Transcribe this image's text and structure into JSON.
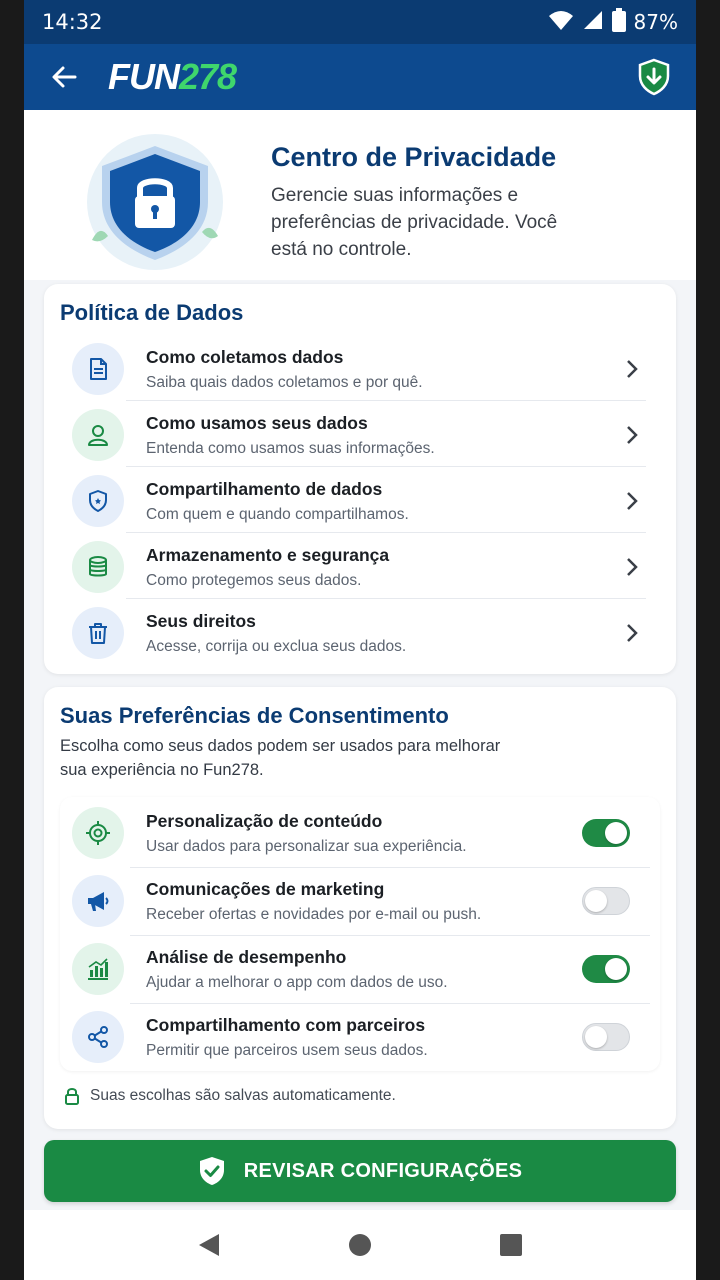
{
  "status": {
    "time": "14:32",
    "battery": "87%"
  },
  "appbar": {
    "logo_fun": "FUN",
    "logo_num": "278",
    "back_icon": "arrow-left-icon",
    "shield_icon": "shield-download-icon"
  },
  "hero": {
    "title": "Centro de Privacidade",
    "subtitle": "Gerencie suas informações e preferências de privacidade. Você está no controle."
  },
  "policy": {
    "title": "Política de Dados",
    "items": [
      {
        "title": "Como coletamos dados",
        "subtitle": "Saiba quais dados coletamos e por quê.",
        "icon": "document-icon"
      },
      {
        "title": "Como usamos seus dados",
        "subtitle": "Entenda como usamos suas informações.",
        "icon": "user-icon"
      },
      {
        "title": "Compartilhamento de dados",
        "subtitle": "Com quem e quando compartilhamos.",
        "icon": "shield-icon"
      },
      {
        "title": "Armazenamento e segurança",
        "subtitle": "Como protegemos seus dados.",
        "icon": "database-icon"
      },
      {
        "title": "Seus direitos",
        "subtitle": "Acesse, corrija ou exclua seus dados.",
        "icon": "trash-icon"
      }
    ]
  },
  "consent": {
    "title": "Suas Preferências de Consentimento",
    "description": "Escolha como seus dados podem ser usados para melhorar sua experiência no Fun278.",
    "items": [
      {
        "title": "Personalização de conteúdo",
        "subtitle": "Usar dados para personalizar sua experiência.",
        "icon": "target-icon",
        "enabled": true
      },
      {
        "title": "Comunicações de marketing",
        "subtitle": "Receber ofertas e novidades por e-mail ou push.",
        "icon": "megaphone-icon",
        "enabled": false
      },
      {
        "title": "Análise de desempenho",
        "subtitle": "Ajudar a melhorar o app com dados de uso.",
        "icon": "bar-chart-icon",
        "enabled": true
      },
      {
        "title": "Compartilhamento com parceiros",
        "subtitle": "Permitir que parceiros usem seus dados.",
        "icon": "share-icon",
        "enabled": false
      }
    ],
    "saved_note": "Suas escolhas são salvas automaticamente."
  },
  "review_button": {
    "label": "REVISAR CONFIGURAÇÕES"
  },
  "colors": {
    "primary": "#0d4a8f",
    "accent_green": "#1a8a44",
    "logo_green": "#3fd66c"
  }
}
